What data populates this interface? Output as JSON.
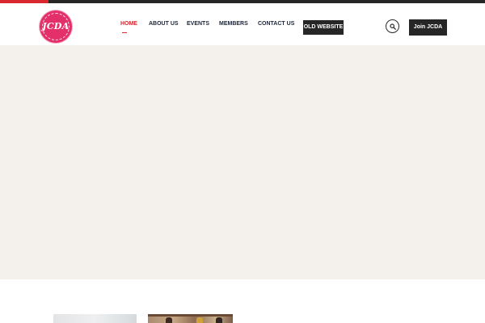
{
  "logo": {
    "text": "JCDA"
  },
  "nav": {
    "items": [
      {
        "label": "HOME",
        "active": true
      },
      {
        "label": "ABOUT US",
        "active": false
      },
      {
        "label": "EVENTS",
        "active": false
      },
      {
        "label": "MEMBERS",
        "active": false
      },
      {
        "label": "CONTACT US",
        "active": false
      }
    ],
    "old_website_label": "OLD WEBSITE"
  },
  "actions": {
    "search_icon": "search-icon",
    "join_label": "Join JCDA"
  },
  "colors": {
    "accent": "#d9272e",
    "dark": "#262626",
    "logo": "#e4306a",
    "hero_bg": "#f4f1ed"
  }
}
